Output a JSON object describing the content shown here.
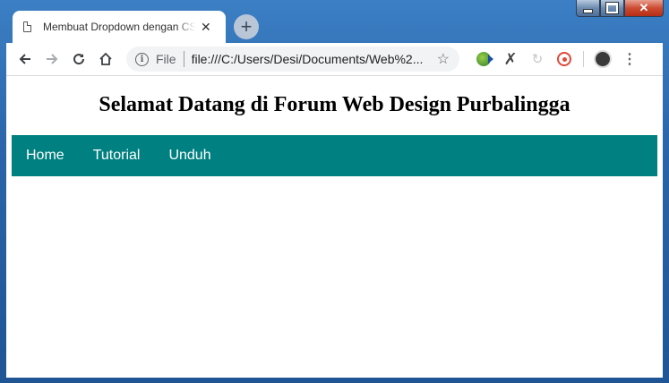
{
  "browser": {
    "tab_title": "Membuat Dropdown dengan CSS",
    "tab_close": "✕",
    "new_tab": "+",
    "address": {
      "scheme_label": "File",
      "url": "file:///C:/Users/Desi/Documents/Web%2..."
    }
  },
  "page": {
    "heading": "Selamat Datang di Forum Web Design Purbalingga",
    "nav": [
      {
        "label": "Home"
      },
      {
        "label": "Tutorial"
      },
      {
        "label": "Unduh"
      }
    ],
    "colors": {
      "navbar_bg": "#008080",
      "nav_text": "#ffffff"
    }
  },
  "icons": {
    "back": "back-arrow-icon",
    "forward": "forward-arrow-icon",
    "reload": "reload-icon",
    "home": "home-icon",
    "info": "info-icon",
    "bookmark": "star-icon",
    "menu": "kebab-menu-icon"
  }
}
